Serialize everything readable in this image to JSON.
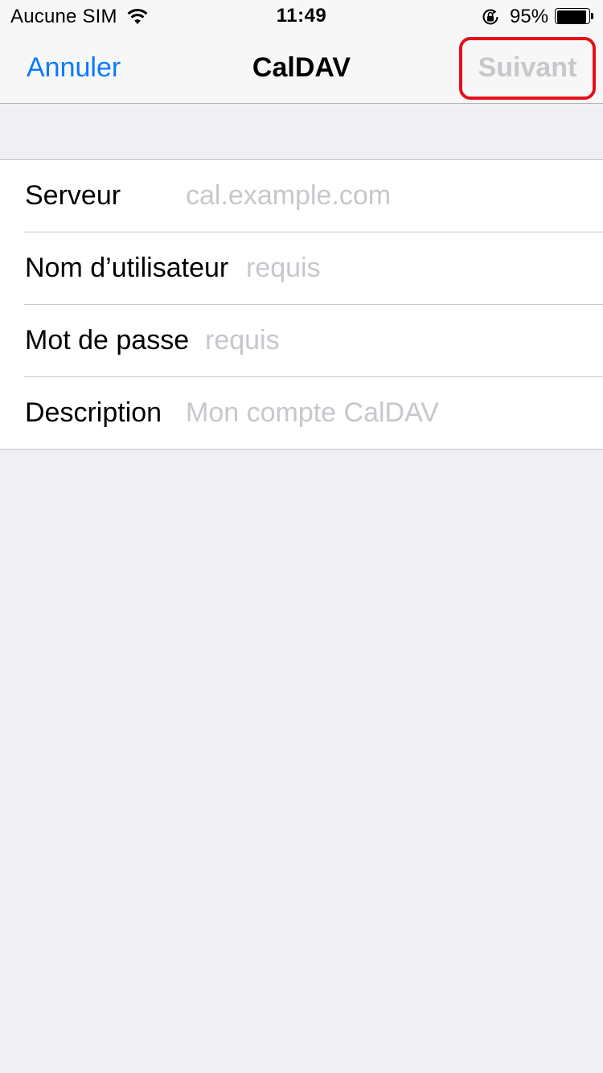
{
  "status_bar": {
    "carrier": "Aucune SIM",
    "time": "11:49",
    "battery_percent": "95%",
    "battery_level": 0.95,
    "icons": [
      "wifi-icon",
      "orientation-lock-icon",
      "battery-icon"
    ]
  },
  "nav": {
    "cancel_label": "Annuler",
    "title": "CalDAV",
    "next_label": "Suivant",
    "next_enabled": false,
    "highlight_color": "#e4111a"
  },
  "form": {
    "fields": [
      {
        "label": "Serveur",
        "value": "",
        "placeholder": "cal.example.com"
      },
      {
        "label": "Nom d’utilisateur",
        "value": "",
        "placeholder": "requis"
      },
      {
        "label": "Mot de passe",
        "value": "",
        "placeholder": "requis"
      },
      {
        "label": "Description",
        "value": "",
        "placeholder": "Mon compte CalDAV"
      }
    ]
  },
  "colors": {
    "accent": "#0a7aff",
    "background": "#efeff4",
    "placeholder": "#c7c7cd",
    "disabled": "#c7c7cc"
  }
}
